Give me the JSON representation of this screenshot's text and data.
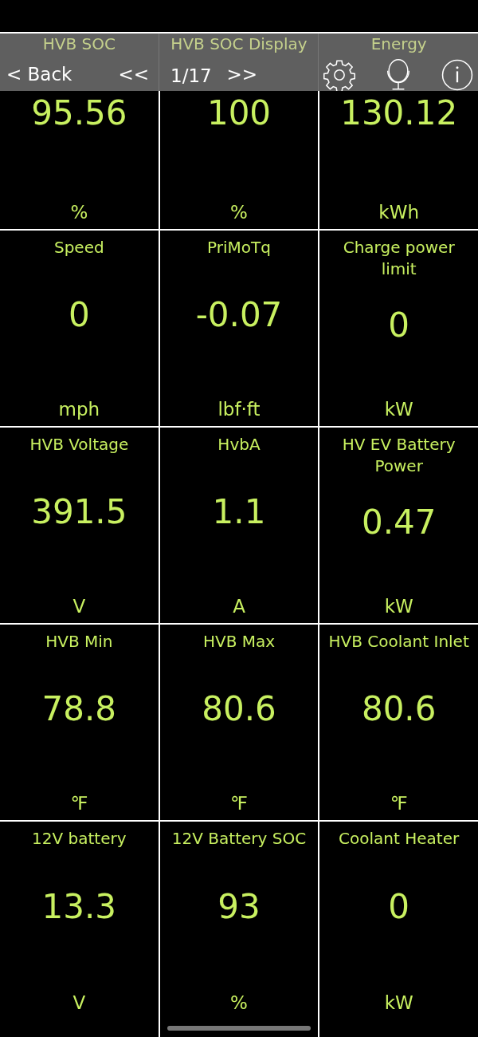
{
  "toolbar": {
    "back": "< Back",
    "prev": "<<",
    "page": "1/17",
    "next": ">>"
  },
  "gauges": [
    {
      "title": "HVB SOC",
      "value": "95.56",
      "unit": "%"
    },
    {
      "title": "HVB SOC Display",
      "value": "100",
      "unit": "%"
    },
    {
      "title": "Energy",
      "value": "130.12",
      "unit": "kWh"
    },
    {
      "title": "Speed",
      "value": "0",
      "unit": "mph"
    },
    {
      "title": "PriMoTq",
      "value": "-0.07",
      "unit": "lbf·ft"
    },
    {
      "title": "Charge power limit",
      "value": "0",
      "unit": "kW"
    },
    {
      "title": "HVB Voltage",
      "value": "391.5",
      "unit": "V"
    },
    {
      "title": "HvbA",
      "value": "1.1",
      "unit": "A"
    },
    {
      "title": "HV EV Battery Power",
      "value": "0.47",
      "unit": "kW"
    },
    {
      "title": "HVB Min",
      "value": "78.8",
      "unit": "℉"
    },
    {
      "title": "HVB Max",
      "value": "80.6",
      "unit": "℉"
    },
    {
      "title": "HVB Coolant Inlet",
      "value": "80.6",
      "unit": "℉"
    },
    {
      "title": "12V battery",
      "value": "13.3",
      "unit": "V"
    },
    {
      "title": "12V Battery SOC",
      "value": "93",
      "unit": "%"
    },
    {
      "title": "Coolant Heater",
      "value": "0",
      "unit": "kW"
    }
  ]
}
